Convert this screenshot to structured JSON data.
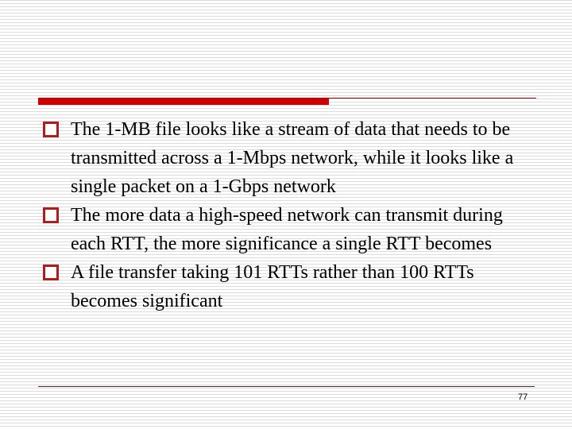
{
  "slide": {
    "bullets": [
      {
        "text": "The 1-MB file looks like a stream of data that needs to be transmitted across a 1-Mbps network, while it looks like a single packet on a 1-Gbps network"
      },
      {
        "text": "The more data a high-speed network can transmit during each RTT,  the more significance a single RTT becomes"
      },
      {
        "text": "A file transfer taking 101 RTTs rather than 100 RTTs becomes significant"
      }
    ],
    "page_number": "77"
  },
  "colors": {
    "accent_bar": "#cc0000",
    "bullet_box": "#b01c1c",
    "footer_rule": "#6b1a2a"
  }
}
